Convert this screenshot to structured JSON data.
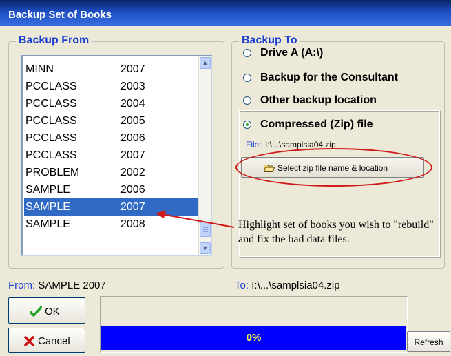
{
  "window": {
    "title": "Backup Set of Books"
  },
  "backup_from": {
    "legend": "Backup From",
    "rows": [
      {
        "name": "MINN",
        "year": "2007"
      },
      {
        "name": "PCCLASS",
        "year": "2003"
      },
      {
        "name": "PCCLASS",
        "year": "2004"
      },
      {
        "name": "PCCLASS",
        "year": "2005"
      },
      {
        "name": "PCCLASS",
        "year": "2006"
      },
      {
        "name": "PCCLASS",
        "year": "2007"
      },
      {
        "name": "PROBLEM",
        "year": "2002"
      },
      {
        "name": "SAMPLE",
        "year": "2006"
      },
      {
        "name": "SAMPLE",
        "year": "2007",
        "selected": true
      },
      {
        "name": "SAMPLE",
        "year": "2008"
      }
    ]
  },
  "backup_to": {
    "legend": "Backup To",
    "options": [
      {
        "label": "Drive A   (A:\\)",
        "checked": false
      },
      {
        "label": "Backup for the Consultant",
        "checked": false
      },
      {
        "label": "Other backup location",
        "checked": false
      },
      {
        "label": "Compressed (Zip) file",
        "checked": true
      }
    ],
    "file_label": "File:",
    "file_value": "I:\\...\\samplsia04.zip",
    "select_button": "Select zip file name & location"
  },
  "annotation": {
    "text": "Highlight set of books you wish to \"rebuild\" and fix the bad data files."
  },
  "status": {
    "from_label": "From:",
    "from_value": "SAMPLE 2007",
    "to_label": "To:",
    "to_value": "I:\\...\\samplsia04.zip"
  },
  "buttons": {
    "ok": "OK",
    "cancel": "Cancel",
    "refresh": "Refresh"
  },
  "progress": {
    "text": "0%",
    "value": 0
  },
  "colors": {
    "accent": "#1A3ED0",
    "progress": "#0000FF",
    "selection": "#316AC5",
    "highlight": "#D01818"
  }
}
